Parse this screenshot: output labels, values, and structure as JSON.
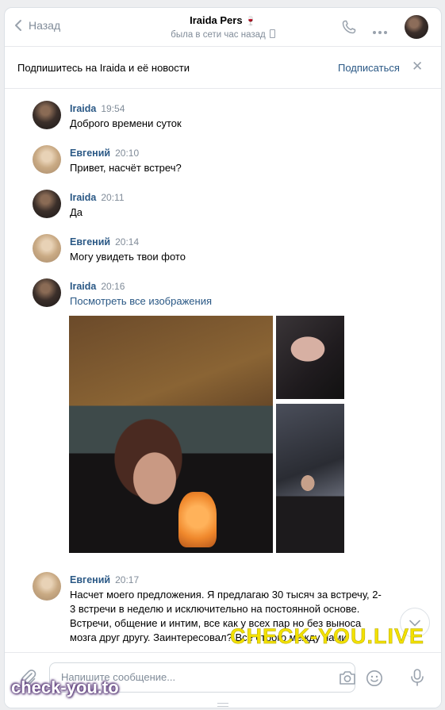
{
  "header": {
    "back_label": "Назад",
    "title": "Iraida Pers",
    "title_emoji": "🍷",
    "status": "была в сети час назад"
  },
  "subscribe_bar": {
    "text": "Подпишитесь на Iraida и её новости",
    "button": "Подписаться"
  },
  "messages": [
    {
      "name": "Iraida",
      "time": "19:54",
      "text": "Доброго времени суток"
    },
    {
      "name": "Евгений",
      "time": "20:10",
      "text": "Привет, насчёт встреч?"
    },
    {
      "name": "Iraida",
      "time": "20:11",
      "text": "Да"
    },
    {
      "name": "Евгений",
      "time": "20:14",
      "text": "Могу увидеть твои фото"
    },
    {
      "name": "Iraida",
      "time": "20:16",
      "text": "Посмотреть все изображения"
    },
    {
      "name": "Евгений",
      "time": "20:17",
      "text": "Насчет моего предложения. Я предлагаю 30 тысяч за встречу, 2-3 встречи в неделю и исключительно на постоянной основе. Встречи, общение и интим, все как у всех пар но без выноса мозга друг другу. Заинтересовал? Все строго между нами"
    }
  ],
  "composer": {
    "placeholder": "Напишите сообщение..."
  },
  "watermarks": {
    "center": "CHECK-YOU.LIVE",
    "corner": "check-you.to"
  },
  "colors": {
    "link": "#2a5885",
    "muted": "#818c99",
    "watermark_yellow": "#f3e100"
  }
}
